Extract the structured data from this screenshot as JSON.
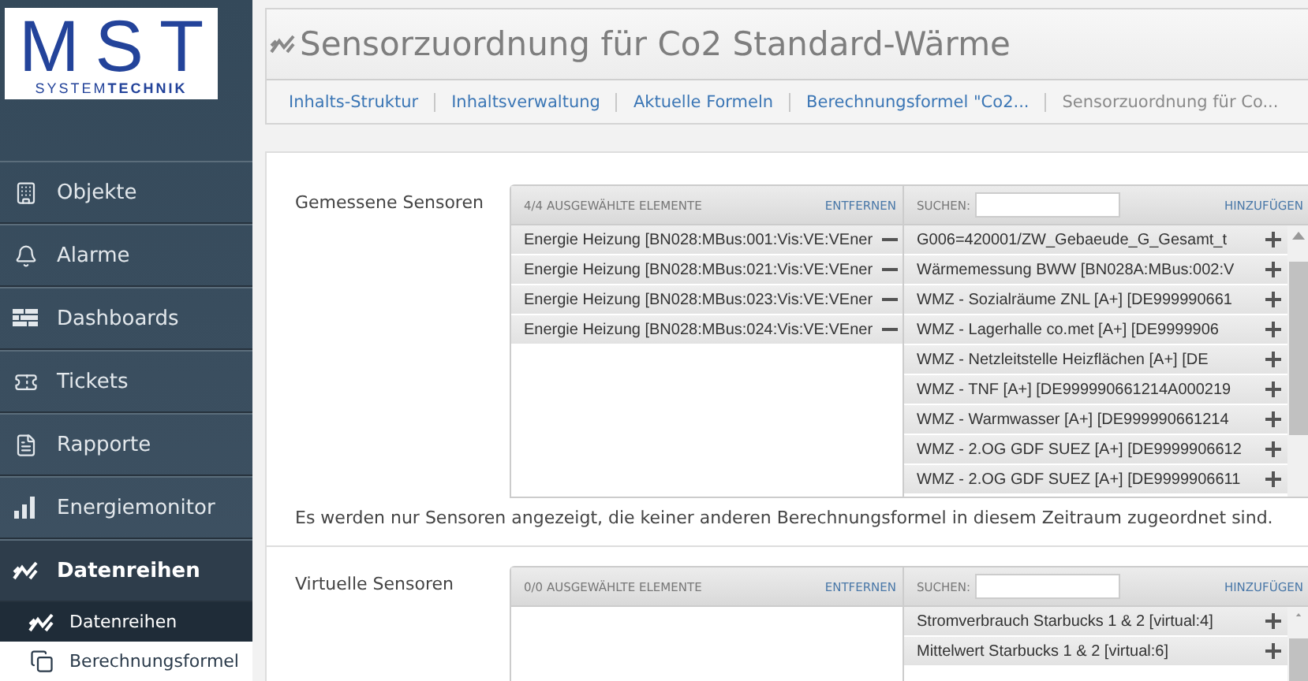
{
  "logo": {
    "main": "MST",
    "sub_light": "SYSTEM",
    "sub_bold": "TECHNIK"
  },
  "sidebar": {
    "items": [
      {
        "label": "Objekte",
        "kind": "building",
        "selected": false
      },
      {
        "label": "Alarme",
        "kind": "bell",
        "selected": false
      },
      {
        "label": "Dashboards",
        "kind": "bricks",
        "selected": false
      },
      {
        "label": "Tickets",
        "kind": "ticket",
        "selected": false
      },
      {
        "label": "Rapporte",
        "kind": "document",
        "selected": false
      },
      {
        "label": "Energiemonitor",
        "kind": "bars",
        "selected": false
      },
      {
        "label": "Datenreihen",
        "kind": "zigzag",
        "selected": true,
        "children": [
          {
            "label": "Datenreihen",
            "kind": "zigzag",
            "selected": true
          },
          {
            "label": "Berechnungsformel",
            "kind": "copy",
            "selected": false
          }
        ]
      }
    ]
  },
  "page": {
    "title": "Sensorzuordnung für Co2 Standard-Wärme",
    "breadcrumbs": [
      {
        "label": "Inhalts-Struktur",
        "current": false
      },
      {
        "label": "Inhaltsverwaltung",
        "current": false
      },
      {
        "label": "Aktuelle Formeln",
        "current": false
      },
      {
        "label": "Berechnungsformel \"Co2...",
        "current": false
      },
      {
        "label": "Sensorzuordnung für Co...",
        "current": true
      }
    ]
  },
  "sections": [
    {
      "label": "Gemessene Sensoren",
      "selected_header": "4/4 AUSGEWÄHLTE ELEMENTE",
      "remove_label": "ENTFERNEN",
      "search_label": "SUCHEN:",
      "add_label": "HINZUFÜGEN",
      "selected_items": [
        "Energie Heizung [BN028:MBus:001:Vis:VE:VEner",
        "Energie Heizung [BN028:MBus:021:Vis:VE:VEner",
        "Energie Heizung [BN028:MBus:023:Vis:VE:VEner",
        "Energie Heizung [BN028:MBus:024:Vis:VE:VEner"
      ],
      "available_items": [
        "G006=420001/ZW_Gebaeude_G_Gesamt_t",
        "Wärmemessung BWW [BN028A:MBus:002:V",
        "WMZ - Sozialräume ZNL [A+] [DE999990661",
        "WMZ - Lagerhalle co.met [A+] [DE9999906",
        "WMZ - Netzleitstelle Heizflächen [A+] [DE",
        "WMZ - TNF [A+] [DE999990661214A000219",
        "WMZ - Warmwasser [A+] [DE999990661214",
        "WMZ - 2.OG GDF SUEZ [A+] [DE9999906612",
        "WMZ - 2.OG GDF SUEZ [A+] [DE9999906611"
      ],
      "note": "Es werden nur Sensoren angezeigt, die keiner anderen Berechnungsformel in diesem Zeitraum zugeordnet sind."
    },
    {
      "label": "Virtuelle Sensoren",
      "selected_header": "0/0 AUSGEWÄHLTE ELEMENTE",
      "remove_label": "ENTFERNEN",
      "search_label": "SUCHEN:",
      "add_label": "HINZUFÜGEN",
      "available_items": [
        "Stromverbrauch Starbucks 1 & 2 [virtual:4]",
        "Mittelwert Starbucks 1 & 2 [virtual:6]"
      ]
    }
  ]
}
